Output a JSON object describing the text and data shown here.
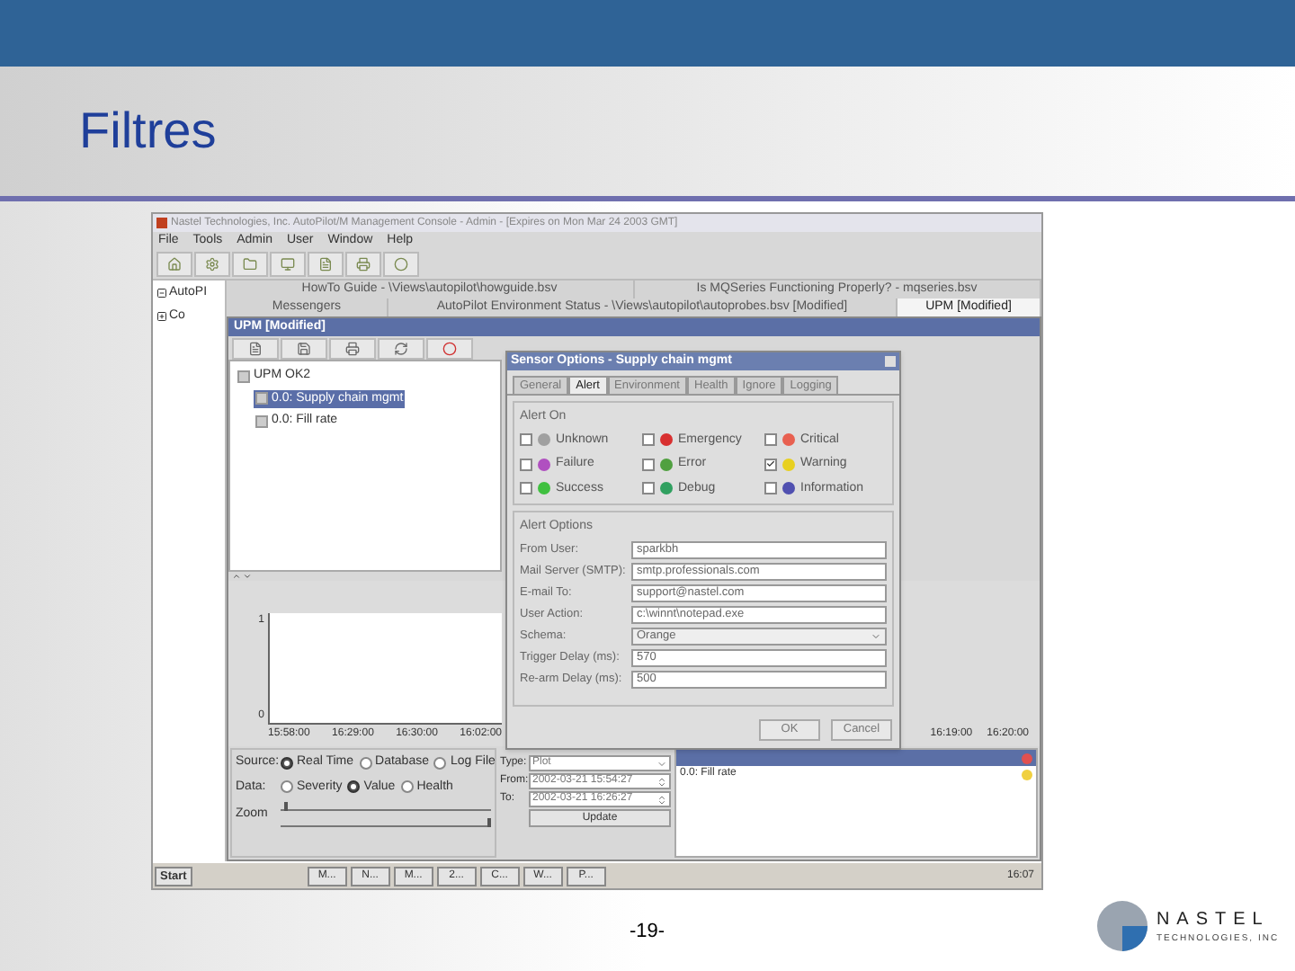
{
  "slide": {
    "title": "Filtres",
    "page_number": "-19-",
    "logo_name": "NASTEL",
    "logo_tagline": "TECHNOLOGIES, INC"
  },
  "window": {
    "title": "Nastel Technologies, Inc. AutoPilot/M Management Console - Admin - [Expires on Mon Mar 24 2003 GMT]"
  },
  "menu": [
    "File",
    "Tools",
    "Admin",
    "User",
    "Window",
    "Help"
  ],
  "side_tree": [
    {
      "label": "AutoPI",
      "expanded": true
    },
    {
      "label": "Co",
      "expanded": false
    }
  ],
  "tabs_row_1": [
    {
      "label": "HowTo Guide - \\Views\\autopilot\\howguide.bsv",
      "selected": false
    },
    {
      "label": "Is MQSeries Functioning Properly? - mqseries.bsv",
      "selected": false
    }
  ],
  "tabs_row_2": [
    {
      "label": "Messengers",
      "selected": false
    },
    {
      "label": "AutoPilot Environment Status - \\Views\\autopilot\\autoprobes.bsv [Modified]",
      "selected": false
    },
    {
      "label": "UPM [Modified]",
      "selected": true
    }
  ],
  "inner_window": {
    "title": "UPM [Modified]",
    "tree": [
      {
        "label": "UPM OK2",
        "selected": false,
        "children": [
          {
            "label": "0.0: Supply chain mgmt",
            "selected": true
          },
          {
            "label": "0.0: Fill rate",
            "selected": false
          }
        ]
      }
    ],
    "chart": {
      "y_ticks": [
        "1",
        "0"
      ],
      "x_labels_left": [
        "15:58:00",
        "16:29:00",
        "16:30:00",
        "16:02:00"
      ],
      "x_labels_right": [
        "16:19:00",
        "16:20:00"
      ]
    },
    "source": {
      "label": "Source:",
      "options": [
        {
          "label": "Real Time",
          "selected": true
        },
        {
          "label": "Database",
          "selected": false
        },
        {
          "label": "Log File",
          "selected": false
        }
      ]
    },
    "data": {
      "label": "Data:",
      "options": [
        {
          "label": "Severity",
          "selected": false
        },
        {
          "label": "Value",
          "selected": true
        },
        {
          "label": "Health",
          "selected": false
        }
      ]
    },
    "zoom": {
      "label": "Zoom",
      "sliders": [
        {
          "level": 0.02
        },
        {
          "level": 0.98
        }
      ]
    },
    "type": {
      "label": "Type:",
      "value": "Plot"
    },
    "from": {
      "label": "From:",
      "value": "2002-03-21 15:54:27"
    },
    "to": {
      "label": "To:",
      "value": "2002-03-21 16:26:27"
    },
    "update_button": "Update",
    "list": [
      {
        "selected": true,
        "color": "#e05050"
      },
      {
        "label": "0.0: Fill rate",
        "selected": false,
        "color": "#f0d040"
      }
    ]
  },
  "dialog": {
    "title": "Sensor Options - Supply chain mgmt",
    "tabs": [
      {
        "label": "General",
        "selected": false
      },
      {
        "label": "Alert",
        "selected": true
      },
      {
        "label": "Environment",
        "selected": false
      },
      {
        "label": "Health",
        "selected": false
      },
      {
        "label": "Ignore",
        "selected": false
      },
      {
        "label": "Logging",
        "selected": false
      }
    ],
    "alert_on": {
      "title": "Alert On",
      "items": [
        {
          "label": "Unknown",
          "checked": false,
          "color": "#a0a0a0"
        },
        {
          "label": "Emergency",
          "checked": false,
          "color": "#d83030"
        },
        {
          "label": "Critical",
          "checked": false,
          "color": "#e86050"
        },
        {
          "label": "Failure",
          "checked": false,
          "color": "#b050c0"
        },
        {
          "label": "Error",
          "checked": false,
          "color": "#50a040"
        },
        {
          "label": "Warning",
          "checked": true,
          "color": "#e8d020"
        },
        {
          "label": "Success",
          "checked": false,
          "color": "#40c040"
        },
        {
          "label": "Debug",
          "checked": false,
          "color": "#30a060"
        },
        {
          "label": "Information",
          "checked": false,
          "color": "#5050b0"
        }
      ]
    },
    "alert_options": {
      "title": "Alert Options",
      "fields": [
        {
          "kind": "text",
          "label": "From User:",
          "value": "sparkbh"
        },
        {
          "kind": "text",
          "label": "Mail Server (SMTP):",
          "value": "smtp.professionals.com"
        },
        {
          "kind": "text",
          "label": "E-mail To:",
          "value": "support@nastel.com"
        },
        {
          "kind": "text",
          "label": "User Action:",
          "value": "c:\\winnt\\notepad.exe"
        },
        {
          "kind": "select",
          "label": "Schema:",
          "value": "Orange"
        },
        {
          "kind": "text",
          "label": "Trigger Delay (ms):",
          "value": "570"
        },
        {
          "kind": "text",
          "label": "Re-arm Delay (ms):",
          "value": "500"
        }
      ]
    },
    "buttons": [
      "OK",
      "Cancel"
    ]
  },
  "taskbar": {
    "start": "Start",
    "tasks": [
      "M...",
      "N...",
      "M...",
      "2...",
      "C...",
      "W...",
      "P..."
    ],
    "clock": "16:07"
  }
}
